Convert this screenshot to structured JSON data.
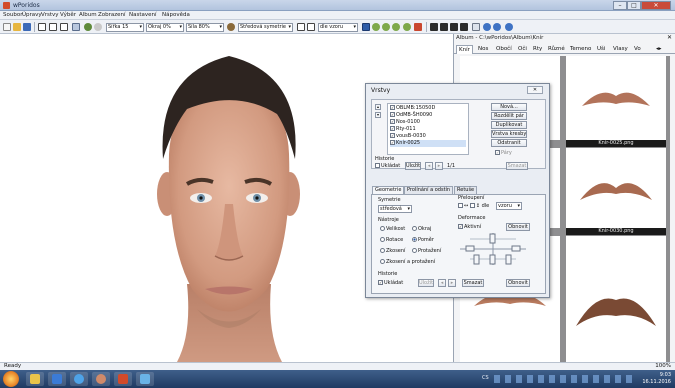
{
  "window": {
    "title": "wPoridos",
    "min": "–",
    "max": "□",
    "close": "✕"
  },
  "menu": [
    "Soubor",
    "Úpravy",
    "Vrstvy",
    "Výběr",
    "Album",
    "Zobrazení",
    "Nastavení",
    "Nápověda"
  ],
  "toolbar": {
    "width_select": "Šířka 15",
    "border_select": "Okraj 0%",
    "strength_select": "Síla 80%",
    "symmetry_select": "Středová symetrie",
    "pattern_select": "dle vzoru"
  },
  "album": {
    "path": "Album - C:\\wPoridos\\Album\\Knír",
    "close": "✕",
    "tabs": [
      "Knír",
      "Nos",
      "Obočí",
      "Oči",
      "Rty",
      "Různé",
      "Temeno",
      "Uši",
      "Vlasy",
      "Vo"
    ],
    "active_tab": "Knír",
    "thumb_labels": [
      "Knír-0025.png",
      "Knír-0030.png"
    ]
  },
  "dialog": {
    "title": "Vrstvy",
    "close": "✕",
    "layers": [
      {
        "name": "OBLMB:15050D",
        "checked": true
      },
      {
        "name": "OdMB-ŠH0090",
        "checked": true
      },
      {
        "name": "Nos-0100",
        "checked": true
      },
      {
        "name": "Rty-011",
        "checked": true
      },
      {
        "name": "vousB-0030",
        "checked": true
      },
      {
        "name": "Knír-0025",
        "checked": true
      }
    ],
    "buttons": {
      "new": "Nová...",
      "split": "Rozdělit pár",
      "duplicate": "Duplikovat",
      "pattern_layer": "Vrstva kresby",
      "remove": "Odstranit"
    },
    "pairs_label": "Páry",
    "history": {
      "title": "Historie",
      "save_label": "Ukládat",
      "save_button": "Uložit",
      "counter": "1/1",
      "clear": "Smazat"
    },
    "tabs": [
      "Geometrie",
      "Prolínání a odstín",
      "Retuše"
    ],
    "active_tab": "Geometrie",
    "symmetry": {
      "title": "Symetrie",
      "value": "středová"
    },
    "flip": {
      "title": "Přeloupení",
      "label": "dle",
      "value": "vzoru"
    },
    "tools": {
      "title": "Nástroje",
      "items": [
        "Velikost",
        "Okraj",
        "Rotace",
        "Poměr",
        "Zkosení",
        "Protažení",
        "Zkosení a protažení"
      ],
      "selected": "Poměr"
    },
    "deform": {
      "title": "Deformace",
      "active_label": "Aktivní",
      "refresh": "Obnovit"
    },
    "history2": {
      "title": "Historie",
      "save_label": "Ukládat",
      "save_button": "Uložit",
      "clear": "Smazat",
      "refresh": "Obnovit"
    }
  },
  "status": {
    "left": "Ready",
    "right": "100%"
  },
  "taskbar": {
    "lang": "CS",
    "time": "9:03",
    "date": "16.11.2016"
  }
}
